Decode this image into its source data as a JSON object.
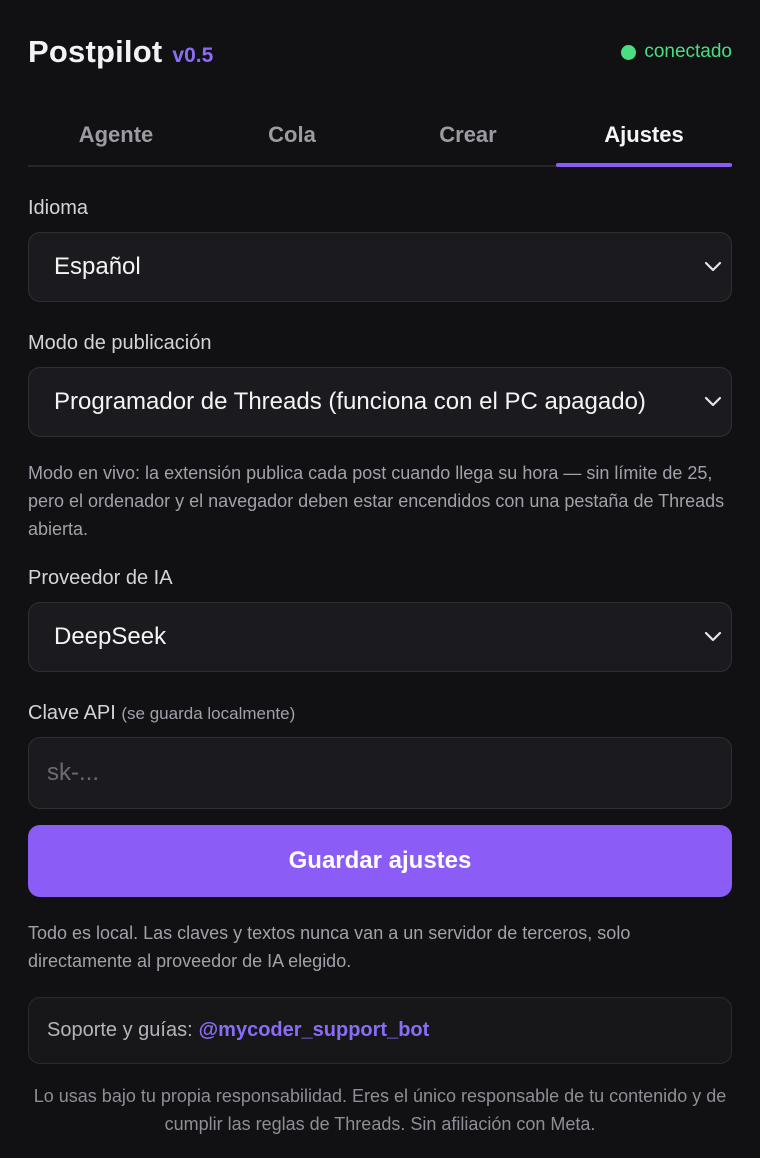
{
  "header": {
    "app_name": "Postpilot",
    "version": "v0.5",
    "status_text": "conectado",
    "status_color": "#4ade80"
  },
  "tabs": [
    {
      "label": "Agente",
      "active": false
    },
    {
      "label": "Cola",
      "active": false
    },
    {
      "label": "Crear",
      "active": false
    },
    {
      "label": "Ajustes",
      "active": true
    }
  ],
  "settings": {
    "language": {
      "label": "Idioma",
      "value": "Español"
    },
    "publish_mode": {
      "label": "Modo de publicación",
      "value": "Programador de Threads (funciona con el PC apagado)",
      "description": "Modo en vivo: la extensión publica cada post cuando llega su hora — sin límite de 25, pero el ordenador y el navegador deben estar encendidos con una pestaña de Threads abierta."
    },
    "ai_provider": {
      "label": "Proveedor de IA",
      "value": "DeepSeek"
    },
    "api_key": {
      "label": "Clave API",
      "hint": "(se guarda localmente)",
      "placeholder": "sk-...",
      "value": ""
    },
    "save_label": "Guardar ajustes",
    "privacy_note": "Todo es local. Las claves y textos nunca van a un servidor de terceros, solo directamente al proveedor de IA elegido."
  },
  "support": {
    "prefix": "Soporte y guías:",
    "link_text": "@mycoder_support_bot"
  },
  "disclaimer": "Lo usas bajo tu propia responsabilidad. Eres el único responsable de tu contenido y de cumplir las reglas de Threads. Sin afiliación con Meta.",
  "colors": {
    "accent": "#8b5cf6",
    "background": "#111113",
    "surface": "#1b1b1f"
  },
  "icons": {
    "status": "status-dot-icon",
    "dropdown": "chevron-down-icon"
  }
}
